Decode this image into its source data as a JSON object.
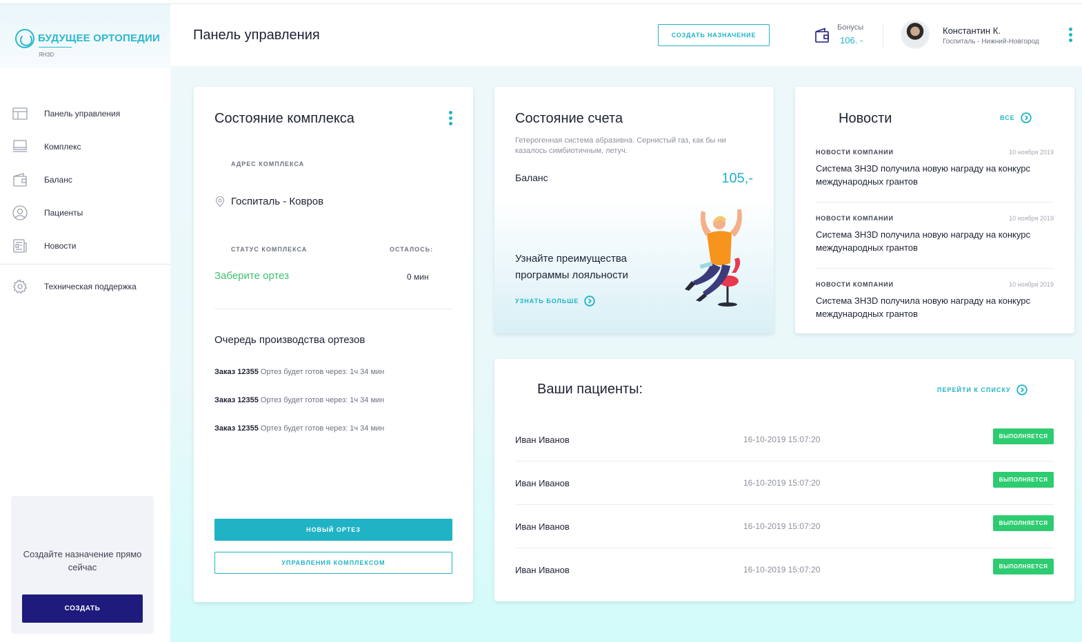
{
  "colors": {
    "accent": "#1fb3c5",
    "brand_dark": "#1e1b7c",
    "success": "#2ecc71",
    "status_text": "#3fbf6e"
  },
  "logo": {
    "name": "БУДУЩЕЕ ОРТОПЕДИИ",
    "sub": "ЯНЗD"
  },
  "sidebar": {
    "items": [
      {
        "label": "Панель управления",
        "icon": "dashboard-icon"
      },
      {
        "label": "Комплекс",
        "icon": "monitor-icon"
      },
      {
        "label": "Баланс",
        "icon": "wallet-icon"
      },
      {
        "label": "Пациенты",
        "icon": "user-icon"
      },
      {
        "label": "Новости",
        "icon": "newspaper-icon"
      }
    ],
    "support": {
      "label": "Техническая поддержка",
      "icon": "gear-icon"
    },
    "promo": {
      "text": "Создайте назначение прямо сейчас",
      "button": "СОЗДАТЬ"
    }
  },
  "header": {
    "title": "Панель управления",
    "create_button": "СОЗДАТЬ НАЗНАЧЕНИЕ",
    "bonus_label": "Бонусы",
    "bonus_value": "106. -",
    "user_name": "Константин К.",
    "user_sub": "Госпиталь - Нижний-Новгород"
  },
  "complex": {
    "title": "Состояние комплекса",
    "address_caption": "АДРЕС КОМПЛЕКСА",
    "address": "Госпиталь - Ковров",
    "status_caption": "СТАТУС КОМПЛЕКСА",
    "left_caption": "ОСТАЛОСЬ:",
    "status": "Заберите ортез",
    "left": "0 мин",
    "queue_title": "Очередь производства ортезов",
    "queue": [
      {
        "order": "Заказ 12355",
        "text": "Ортез будет готов через: 1ч 34 мин"
      },
      {
        "order": "Заказ 12355",
        "text": "Ортез будет готов через: 1ч 34 мин"
      },
      {
        "order": "Заказ 12355",
        "text": "Ортез будет готов через: 1ч 34 мин"
      }
    ],
    "new_button": "НОВЫЙ ОРТЕЗ",
    "manage_button": "УПРАВЛЕНИЯ КОМПЛЕКСОМ"
  },
  "account": {
    "title": "Состояние счета",
    "description": "Гетерогенная система абразивна. Сернистый газ, как бы ни казалось симбиотичным, летуч.",
    "balance_label": "Баланс",
    "balance_value": "105,-",
    "loyalty_text": "Узнайте преимущества программы лояльности",
    "learn_more": "УЗНАТЬ БОЛЬШЕ"
  },
  "news": {
    "title": "Новости",
    "all_link": "ВСЕ",
    "items": [
      {
        "category": "НОВОСТИ КОМПАНИИ",
        "date": "10 ноября 2019",
        "text": "Система ЗНЗD получила новую награду на конкурс международных грантов"
      },
      {
        "category": "НОВОСТИ КОМПАНИИ",
        "date": "10 ноября 2019",
        "text": "Система ЗНЗD получила новую награду на конкурс международных грантов"
      },
      {
        "category": "НОВОСТИ КОМПАНИИ",
        "date": "10 ноября 2019",
        "text": "Система ЗНЗD получила новую награду на конкурс международных грантов"
      }
    ]
  },
  "patients": {
    "title": "Ваши пациенты:",
    "list_link": "ПЕРЕЙТИ К СПИСКУ",
    "rows": [
      {
        "name": "Иван Иванов",
        "date": "16-10-2019 15:07:20",
        "status": "ВЫПОЛНЯЕТСЯ"
      },
      {
        "name": "Иван Иванов",
        "date": "16-10-2019 15:07:20",
        "status": "ВЫПОЛНЯЕТСЯ"
      },
      {
        "name": "Иван Иванов",
        "date": "16-10-2019 15:07:20",
        "status": "ВЫПОЛНЯЕТСЯ"
      },
      {
        "name": "Иван Иванов",
        "date": "16-10-2019 15:07:20",
        "status": "ВЫПОЛНЯЕТСЯ"
      }
    ]
  }
}
